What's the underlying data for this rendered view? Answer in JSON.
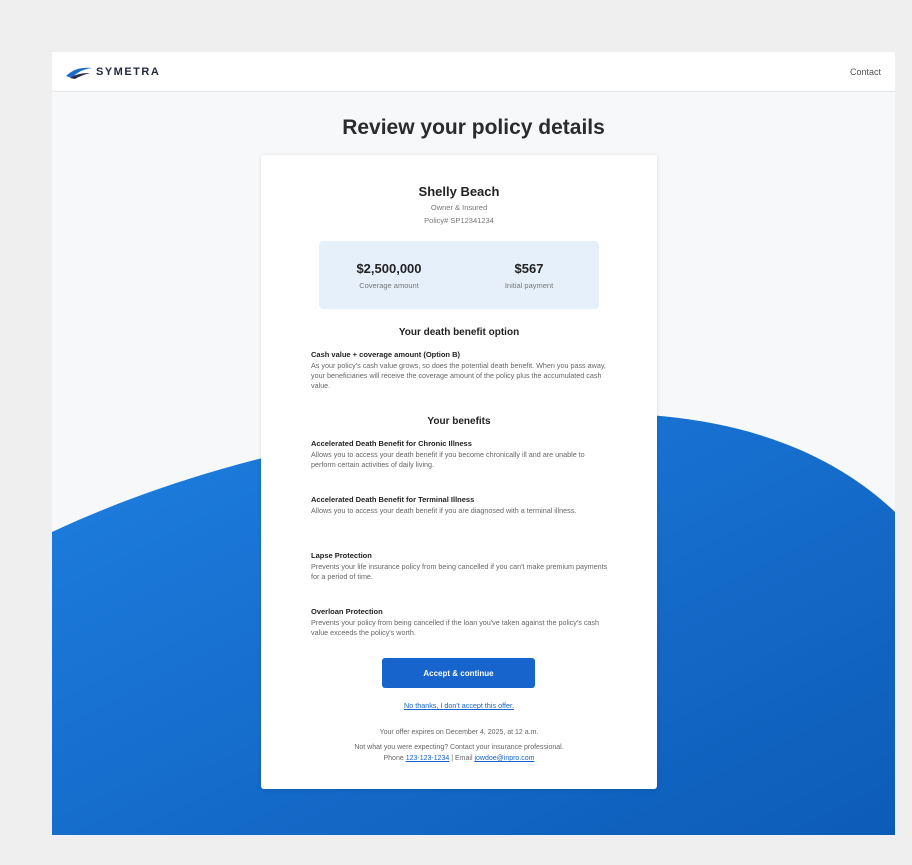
{
  "header": {
    "brand": "SYMETRA",
    "contact_label": "Contact"
  },
  "page": {
    "title": "Review your policy details"
  },
  "insured": {
    "name": "Shelly Beach",
    "role": "Owner & Insured",
    "policy": "Policy# SP12341234"
  },
  "amounts": {
    "coverage_value": "$2,500,000",
    "coverage_label": "Coverage amount",
    "payment_value": "$567",
    "payment_label": "Initial payment"
  },
  "death_benefit": {
    "section_title": "Your death benefit option",
    "option_title": "Cash value + coverage amount (Option B)",
    "option_desc": "As your policy's cash value grows, so does the potential death benefit. When you pass away, your beneficiaries will receive the coverage amount of the policy plus the accumulated cash value."
  },
  "benefits": {
    "section_title": "Your benefits",
    "items": [
      {
        "title": "Accelerated Death Benefit for Chronic Illness",
        "desc": "Allows you to access your death benefit if you become chronically ill and are unable to perform certain activities of daily living."
      },
      {
        "title": "Accelerated Death Benefit for Terminal Illness",
        "desc": "Allows you to access your death benefit if you are diagnosed with a terminal illness."
      },
      {
        "title": "Lapse Protection",
        "desc": "Prevents your life insurance policy from being cancelled if you can't make premium payments for a period of time."
      },
      {
        "title": "Overloan Protection",
        "desc": "Prevents your policy from being cancelled if the loan you've taken against the policy's cash value exceeds the policy's worth."
      }
    ]
  },
  "actions": {
    "accept_label": "Accept & continue",
    "decline_label": "No thanks, I don't accept this offer."
  },
  "footer": {
    "expires": "Your offer expires on December 4, 2025, at 12 a.m.",
    "contact_prompt": "Not what you were expecting? Contact your insurance professional.",
    "phone_label": "Phone",
    "phone": "123-123-1234",
    "separator": "| Email",
    "email": "jowdoe@inpro.com"
  },
  "colors": {
    "accent": "#1664cc",
    "wave": "#1a6fd1",
    "amount_bg": "#e6f0fa"
  }
}
